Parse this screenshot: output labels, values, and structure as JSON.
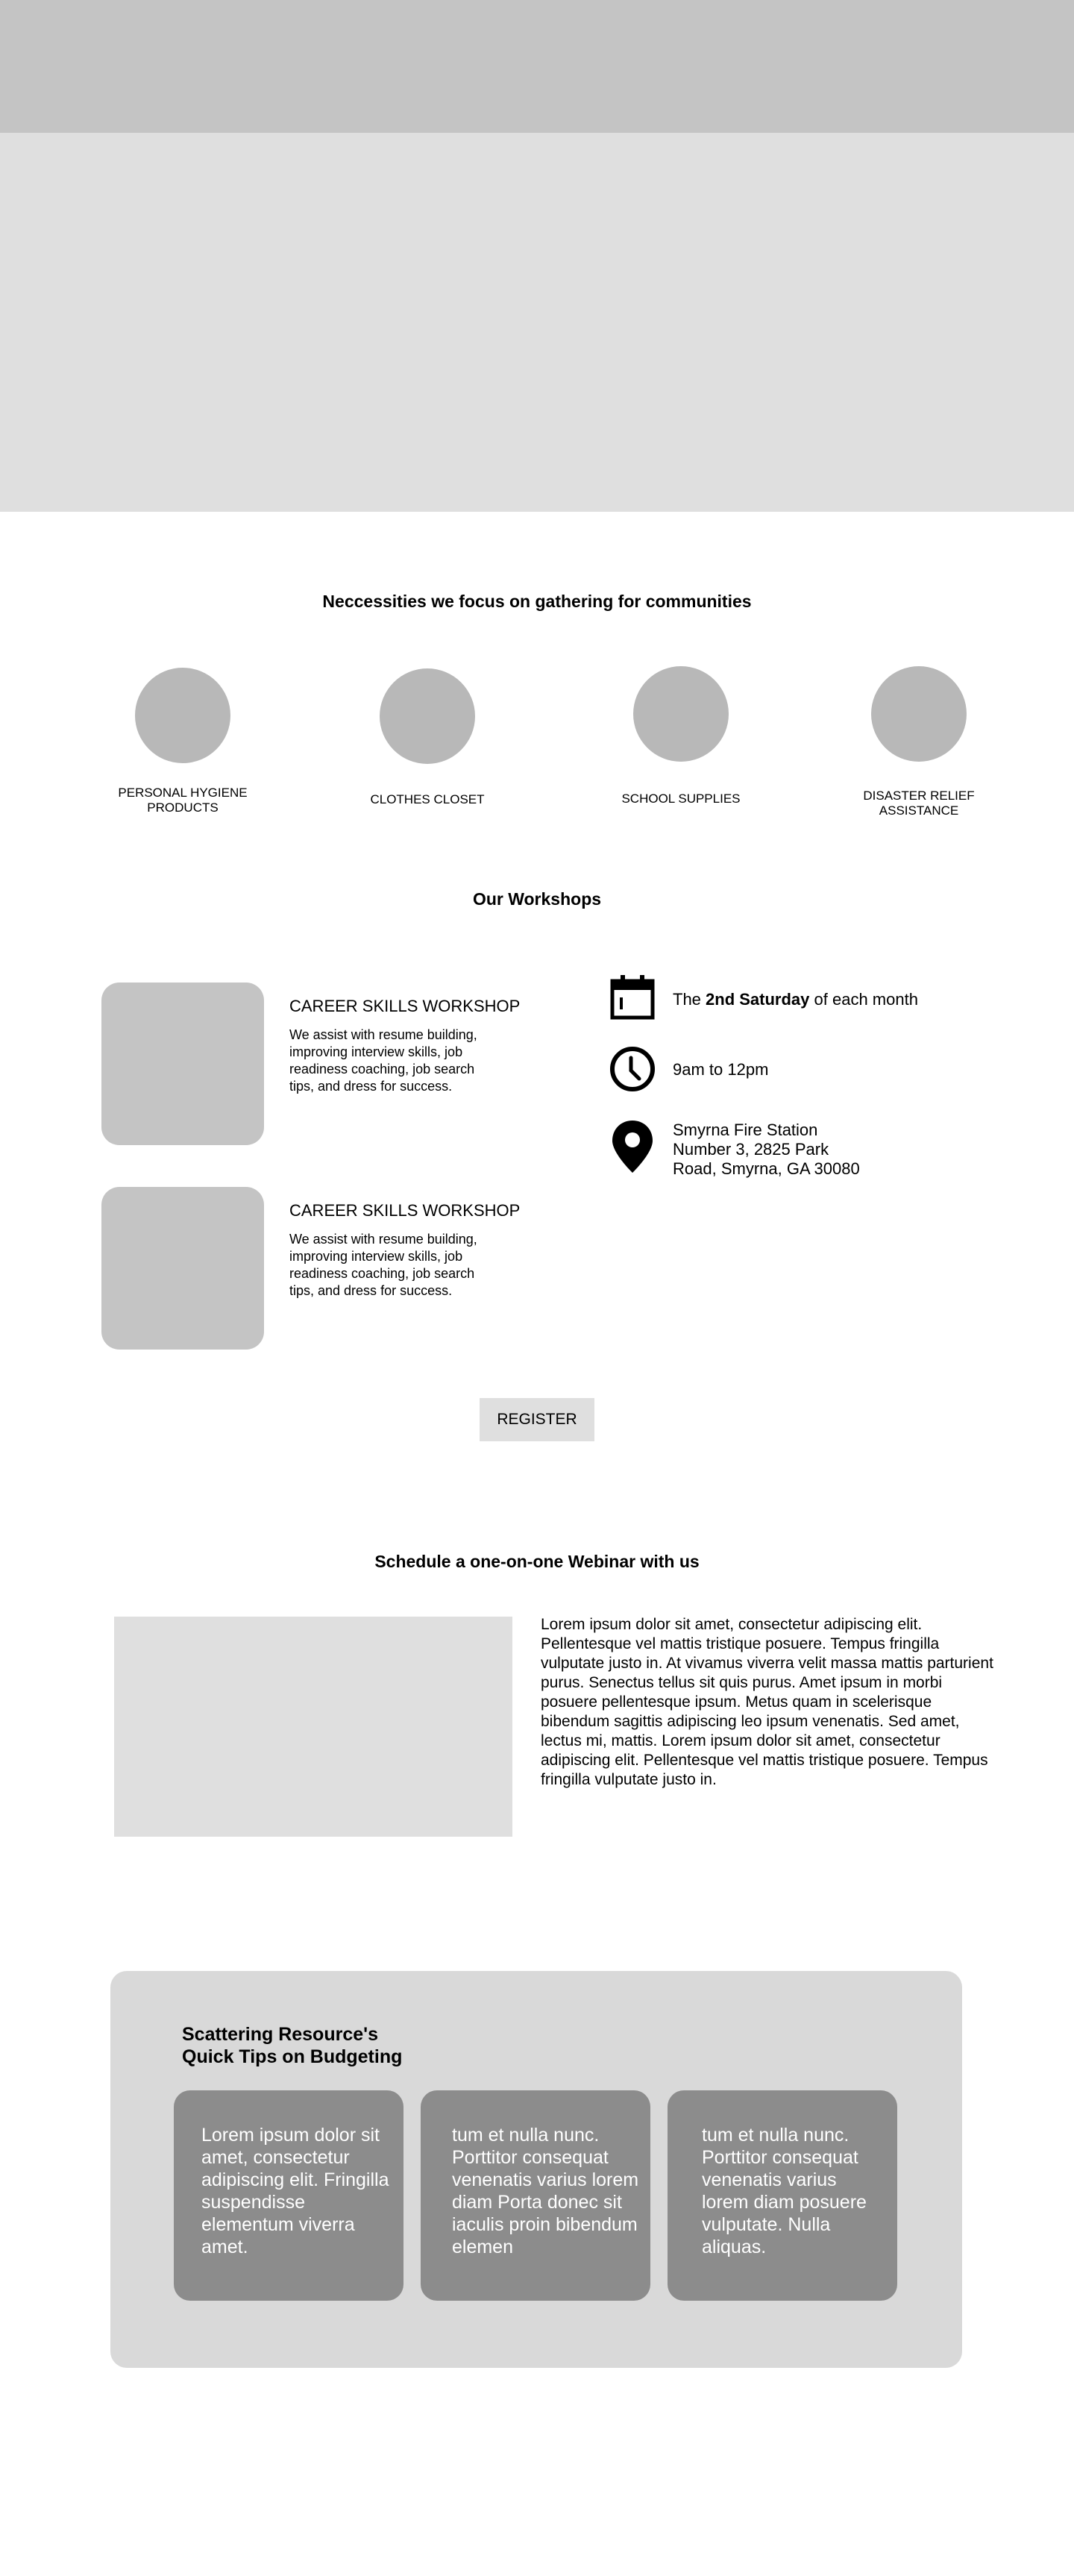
{
  "necessities": {
    "title": "Neccessities we focus on gathering for communities",
    "items": [
      {
        "label": "PERSONAL HYGIENE\nPRODUCTS"
      },
      {
        "label": "CLOTHES CLOSET"
      },
      {
        "label": "SCHOOL SUPPLIES"
      },
      {
        "label": "DISASTER RELIEF\nASSISTANCE"
      }
    ]
  },
  "workshops": {
    "title": "Our Workshops",
    "items": [
      {
        "title": "CAREER SKILLS WORKSHOP",
        "description": "We assist with resume building, improving interview skills, job readiness coaching, job search tips, and dress for success."
      },
      {
        "title": "CAREER SKILLS WORKSHOP",
        "description": "We assist with resume building, improving interview skills, job readiness coaching, job search tips, and dress for success."
      }
    ],
    "schedule": {
      "date_prefix": "The ",
      "date_bold": "2nd Saturday",
      "date_suffix": " of each month",
      "time": "9am to 12pm",
      "location_line1": "Smyrna Fire Station",
      "location_line2": "Number 3, 2825 Park",
      "location_line3": "Road, Smyrna, GA 30080"
    },
    "register_label": "REGISTER"
  },
  "webinar": {
    "title": "Schedule a one-on-one Webinar with us",
    "body": "Lorem ipsum dolor sit amet, consectetur adipiscing elit. Pellentesque vel mattis tristique posuere. Tempus fringilla vulputate justo in. At vivamus viverra velit massa mattis parturient purus. Senectus tellus sit quis purus. Amet ipsum in morbi posuere pellentesque ipsum. Metus quam in scelerisque bibendum sagittis adipiscing leo ipsum venenatis. Sed amet, lectus mi, mattis. Lorem ipsum dolor sit amet, consectetur adipiscing elit. Pellentesque vel mattis tristique posuere. Tempus fringilla vulputate justo in."
  },
  "tips": {
    "title_line1": "Scattering Resource's",
    "title_line2": "Quick Tips on Budgeting",
    "cards": [
      {
        "text": "Lorem ipsum dolor sit amet, consectetur adipiscing elit. Fringilla suspendisse elementum viverra amet."
      },
      {
        "text": "tum et nulla nunc. Porttitor consequat venenatis varius lorem diam Porta donec sit iaculis proin bibendum elemen"
      },
      {
        "text": "tum et nulla nunc. Porttitor consequat venenatis varius lorem diam posuere vulputate. Nulla aliquas."
      }
    ]
  },
  "colors": {
    "topbar": "#c4c4c4",
    "hero": "#dfdfdf",
    "placeholder": "#b8b8b8",
    "panel": "#d9d9d9",
    "tip_card": "#8c8c8c"
  }
}
